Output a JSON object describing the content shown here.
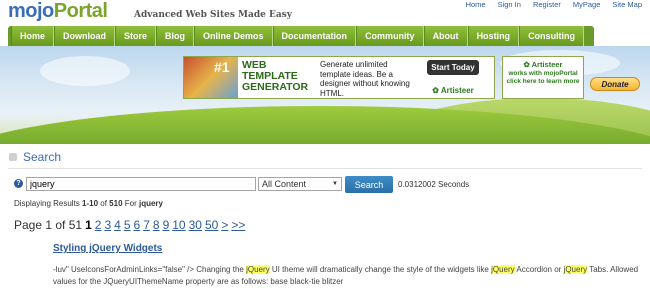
{
  "header": {
    "logo_mojo": "mojo",
    "logo_portal": "Portal",
    "tagline": "Advanced Web Sites Made Easy",
    "toplinks": [
      "Home",
      "Sign In",
      "Register",
      "MyPage",
      "Site Map"
    ]
  },
  "nav": [
    "Home",
    "Download",
    "Store",
    "Blog",
    "Online Demos",
    "Documentation",
    "Community",
    "About",
    "Hosting",
    "Consulting"
  ],
  "banner": {
    "ad_number": "#1",
    "ad_title_lines": [
      "WEB",
      "TEMPLATE",
      "GENERATOR"
    ],
    "ad_text": "Generate unlimited template ideas. Be a designer without knowing HTML.",
    "ad_button": "Start Today",
    "ad_brand": "Artisteer",
    "ad2_brand": "Artisteer",
    "ad2_text": "works with mojoPortal click here to learn more",
    "donate": "Donate"
  },
  "search": {
    "heading": "Search",
    "help": "?",
    "query": "jquery",
    "scope": "All Content",
    "button": "Search",
    "elapsed": "0.0312002 Seconds",
    "results_prefix": "Displaying Results ",
    "results_range": "1-10",
    "results_of": " of ",
    "results_total": "510",
    "results_for": " For ",
    "results_query": "jquery"
  },
  "pager": {
    "label": "Page 1 of 51",
    "current": "1",
    "pages": [
      "2",
      "3",
      "4",
      "5",
      "6",
      "7",
      "8",
      "9",
      "10",
      "30",
      "50",
      ">",
      ">>"
    ]
  },
  "result": {
    "title": "Styling jQuery Widgets",
    "snippet_parts": [
      "-luv\" UseIconsForAdminLinks=\"false\" /> Changing the ",
      "jQuery",
      " UI theme will dramatically change the style of the widgets like ",
      "jQuery",
      " Accordion or ",
      "jQuery",
      " Tabs. Allowed values for the JQueryUIThemeName property are as follows: base black-tie blitzer"
    ]
  }
}
